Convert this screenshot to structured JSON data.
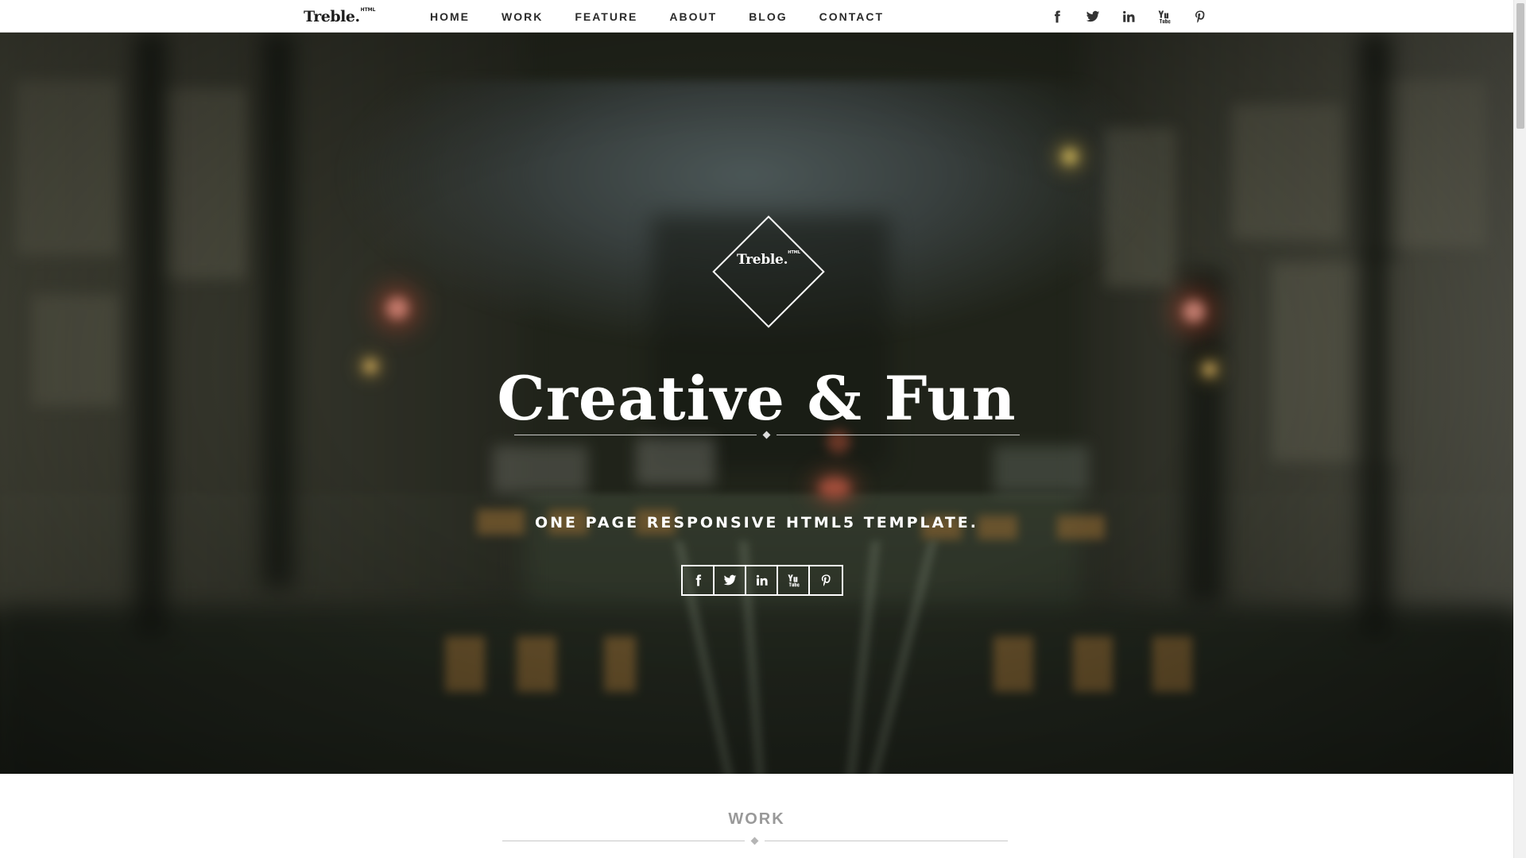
{
  "brand": {
    "name": "Treble.",
    "sup": "HTML"
  },
  "nav": {
    "items": [
      {
        "label": "HOME"
      },
      {
        "label": "WORK"
      },
      {
        "label": "FEATURE"
      },
      {
        "label": "ABOUT"
      },
      {
        "label": "BLOG"
      },
      {
        "label": "CONTACT"
      }
    ],
    "social_icons": [
      "facebook-icon",
      "twitter-icon",
      "linkedin-icon",
      "youtube-icon",
      "pinterest-icon"
    ]
  },
  "hero": {
    "logo": {
      "name": "Treble.",
      "sup": "HTML"
    },
    "title": "Creative & Fun",
    "subtitle": "ONE PAGE RESPONSIVE HTML5 TEMPLATE.",
    "social_icons": [
      "facebook-icon",
      "twitter-icon",
      "linkedin-icon",
      "youtube-icon",
      "pinterest-icon"
    ]
  },
  "work": {
    "heading": "WORK"
  },
  "colors": {
    "nav_text": "#2a2a2a",
    "hero_text": "#ffffff",
    "section_heading": "#999999"
  }
}
